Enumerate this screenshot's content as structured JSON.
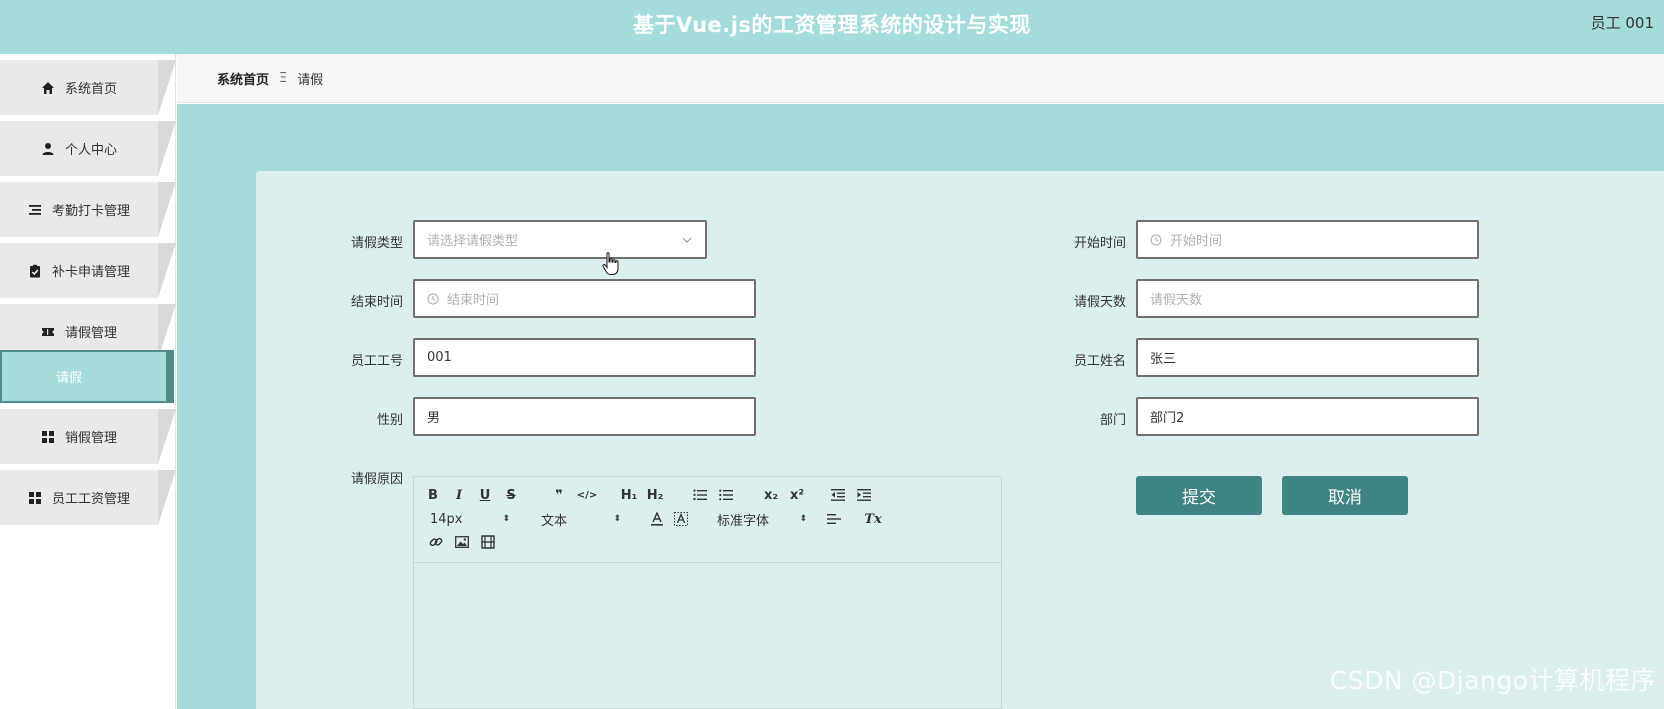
{
  "header": {
    "title": "基于Vue.js的工资管理系统的设计与实现",
    "user": "员工 001"
  },
  "sidebar": {
    "items": [
      {
        "label": "系统首页",
        "icon": "home-icon"
      },
      {
        "label": "个人中心",
        "icon": "user-icon"
      },
      {
        "label": "考勤打卡管理",
        "icon": "list-icon"
      },
      {
        "label": "补卡申请管理",
        "icon": "clipboard-check-icon"
      },
      {
        "label": "请假管理",
        "icon": "ticket-icon"
      },
      {
        "label": "销假管理",
        "icon": "grid-icon"
      },
      {
        "label": "员工工资管理",
        "icon": "grid-icon"
      }
    ],
    "active_submenu": "请假"
  },
  "breadcrumb": {
    "home": "系统首页",
    "separator": "Ξ",
    "current": "请假"
  },
  "form": {
    "leave_type": {
      "label": "请假类型",
      "placeholder": "请选择请假类型"
    },
    "start_time": {
      "label": "开始时间",
      "placeholder": "开始时间"
    },
    "end_time": {
      "label": "结束时间",
      "placeholder": "结束时间"
    },
    "leave_days": {
      "label": "请假天数",
      "placeholder": "请假天数"
    },
    "employee_id": {
      "label": "员工工号",
      "value": "001"
    },
    "employee_name": {
      "label": "员工姓名",
      "value": "张三"
    },
    "gender": {
      "label": "性别",
      "value": "男"
    },
    "department": {
      "label": "部门",
      "value": "部门2"
    },
    "reason": {
      "label": "请假原因"
    }
  },
  "editor": {
    "font_size": "14px",
    "text_type": "文本",
    "font_family": "标准字体",
    "bold": "B",
    "italic": "I",
    "underline": "U",
    "strike": "S",
    "quote": "❞",
    "code": "</>",
    "h1": "H₁",
    "h2": "H₂",
    "sub": "x₂",
    "sup": "x²",
    "clean": "Tx"
  },
  "buttons": {
    "submit": "提交",
    "cancel": "取消"
  },
  "watermark": "CSDN @Django计算机程序",
  "colors": {
    "accent": "#a4dcdc",
    "button": "#3f8585",
    "panel": "#dbefee"
  }
}
